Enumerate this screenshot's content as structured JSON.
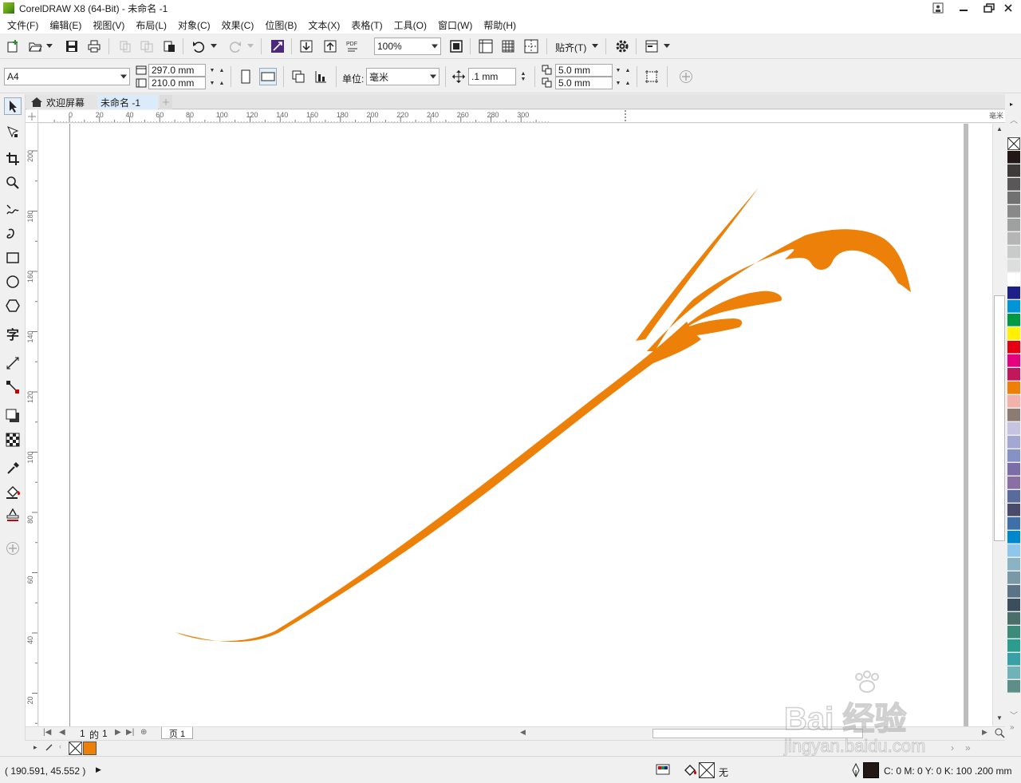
{
  "window": {
    "title": "CorelDRAW X8 (64-Bit) - 未命名 -1"
  },
  "menu": [
    "文件(F)",
    "编辑(E)",
    "视图(V)",
    "布局(L)",
    "对象(C)",
    "效果(C)",
    "位图(B)",
    "文本(X)",
    "表格(T)",
    "工具(O)",
    "窗口(W)",
    "帮助(H)"
  ],
  "toolbar": {
    "zoom_value": "100%",
    "snap_label": "贴齐(T)"
  },
  "property_bar": {
    "page_size": "A4",
    "width": "297.0 mm",
    "height": "210.0 mm",
    "units_label": "单位:",
    "units_value": "毫米",
    "nudge": ".1 mm",
    "dup_x": "5.0 mm",
    "dup_y": "5.0 mm"
  },
  "tabs": [
    {
      "label": "欢迎屏幕",
      "active": false
    },
    {
      "label": "未命名 -1",
      "active": true
    }
  ],
  "rulers": {
    "horizontal": [
      "0",
      "20",
      "40",
      "60",
      "80",
      "100",
      "120",
      "140",
      "160",
      "180",
      "200",
      "220",
      "240",
      "260",
      "280",
      "300"
    ],
    "horizontal_unit": "毫米",
    "vertical": [
      "200",
      "180",
      "160",
      "140",
      "120",
      "100",
      "80",
      "60",
      "40",
      "20"
    ]
  },
  "page_nav": {
    "current": "1",
    "of_label": "的",
    "total": "1",
    "page_tab": "页 1"
  },
  "status": {
    "coordinates": "( 190.591, 45.552 )",
    "fill_label": "无",
    "color_readout": "C: 0 M: 0 Y: 0 K: 100  .200 mm"
  },
  "artwork": {
    "fill_color": "#ec8008"
  },
  "palette": [
    "#231815",
    "#3e3a39",
    "#595757",
    "#727171",
    "#898989",
    "#9fa0a0",
    "#b5b5b6",
    "#c9caca",
    "#dcdddd",
    "#ffffff",
    "#1d2088",
    "#0094d8",
    "#009944",
    "#fff100",
    "#e60012",
    "#e4007f",
    "#c2185b",
    "#ec8008",
    "#f3b2a9",
    "#8b7b72",
    "#c4c3e0",
    "#a3a7d2",
    "#8692c6",
    "#7b6ea8",
    "#8a6fa5",
    "#596a9c",
    "#4a4a6a",
    "#3e6fa8",
    "#0088cf",
    "#8fc7ec",
    "#8ab3c4",
    "#7a99a8",
    "#5a7386",
    "#3b4e5e",
    "#4a6e6a",
    "#3b8a7a",
    "#2a9d8f",
    "#3aa0a8",
    "#6fb3b8",
    "#5f8e88"
  ],
  "watermark": {
    "line1": "Bai 经验",
    "line2": "jingyan.baidu.com"
  }
}
